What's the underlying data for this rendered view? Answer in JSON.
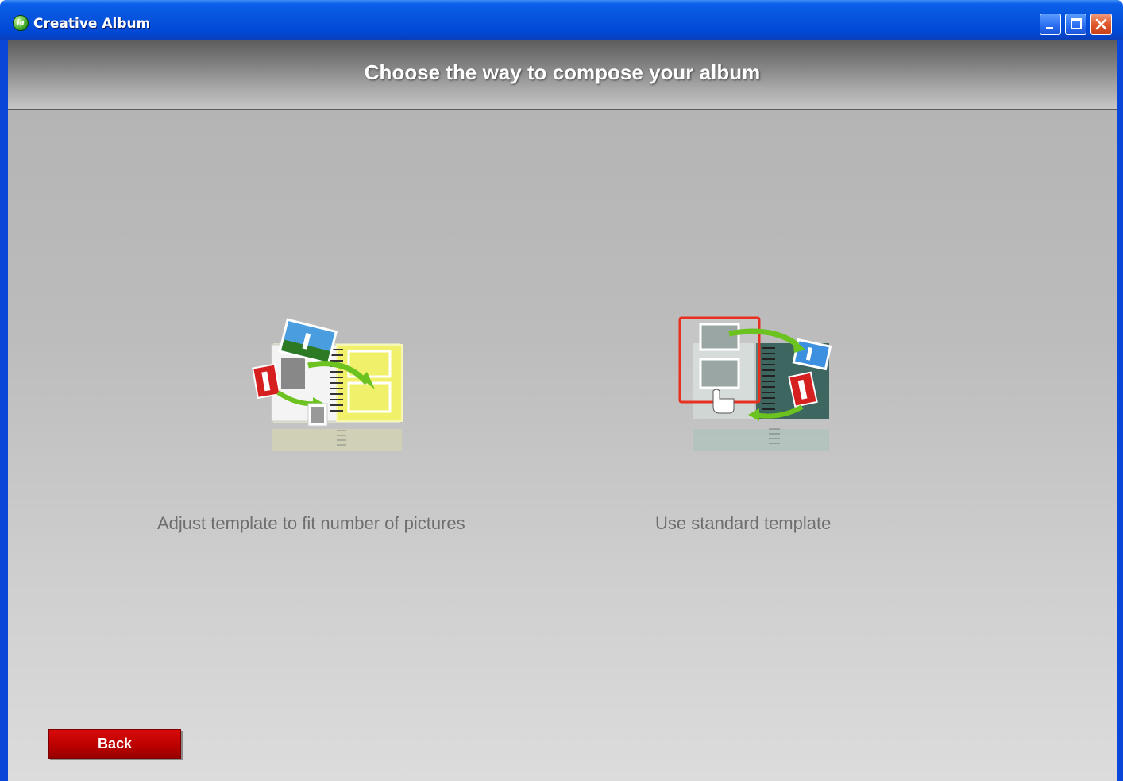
{
  "window": {
    "title": "Creative Album",
    "app_icon": "creative-album-app-icon",
    "app_icon_text": "ia",
    "controls": {
      "minimize": "minimize-icon",
      "maximize": "maximize-icon",
      "close": "close-icon"
    }
  },
  "header": {
    "title": "Choose the way to compose your album"
  },
  "options": [
    {
      "label": "Adjust template to fit number of pictures",
      "icon": "adjust-template-album-icon",
      "accent": "#e8e85a"
    },
    {
      "label": "Use standard template",
      "icon": "standard-template-album-icon",
      "accent": "#e83020"
    }
  ],
  "footer": {
    "back_label": "Back",
    "back_color": "#c00000"
  },
  "colors": {
    "titlebar": "#0a54dc",
    "header_text": "#ffffff",
    "label_text": "#6e6e6e"
  }
}
